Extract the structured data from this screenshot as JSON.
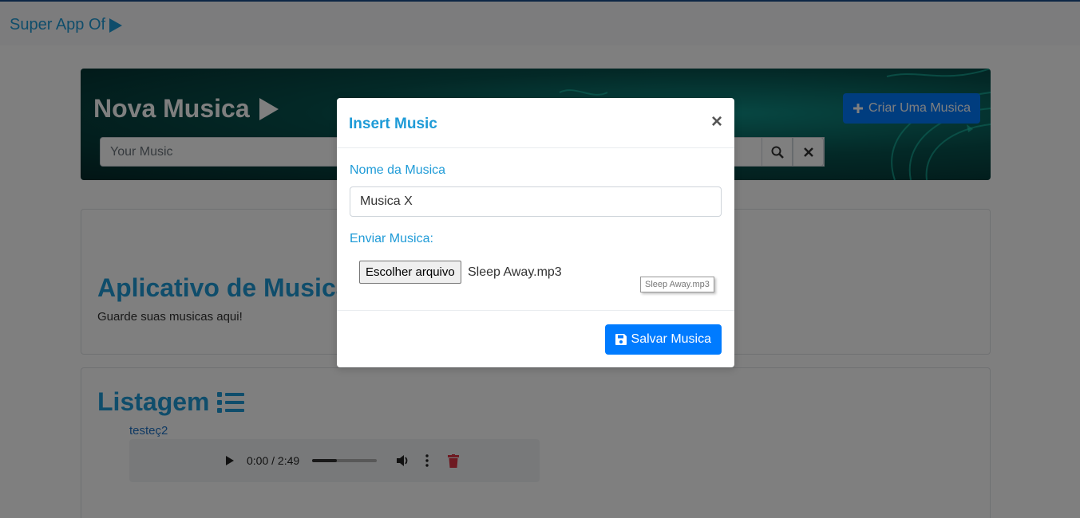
{
  "navbar": {
    "brand": "Super App Of"
  },
  "banner": {
    "title": "Nova Musica",
    "search_placeholder": "Your Music",
    "create_button": "Criar Uma Musica"
  },
  "app_card": {
    "title": "Aplicativo de Musica",
    "subtitle": "Guarde suas musicas aqui!"
  },
  "listing": {
    "title": "Listagem",
    "tracks": [
      {
        "name": "testeç2",
        "time": "0:00 / 2:49",
        "progress": 0.38
      }
    ]
  },
  "modal": {
    "title": "Insert Music",
    "close": "×",
    "name_label": "Nome da Musica",
    "name_value": "Musica X",
    "file_label": "Enviar Musica:",
    "file_button": "Escolher arquivo",
    "file_name": "Sleep Away.mp3",
    "file_tooltip": "Sleep Away.mp3",
    "save_button": "Salvar Musica"
  },
  "colors": {
    "accent": "#1f9bd7",
    "primary": "#007bff",
    "danger": "#dc3545"
  }
}
